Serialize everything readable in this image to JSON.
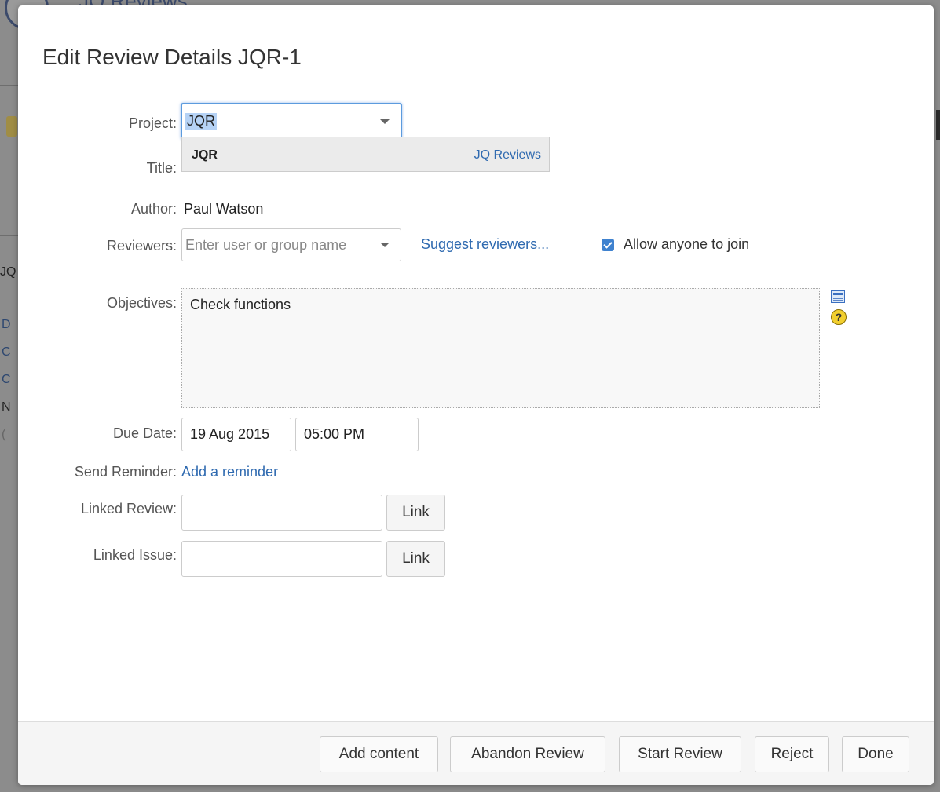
{
  "background": {
    "app_title": "JQ Reviews",
    "side_chars": [
      "JQ",
      "D",
      "C",
      "C",
      "N",
      "("
    ]
  },
  "dialog": {
    "title": "Edit Review Details JQR-1",
    "project": {
      "label": "Project:",
      "value": "JQR",
      "dropdown_key": "JQR",
      "dropdown_name": "JQ Reviews"
    },
    "title_field": {
      "label": "Title:"
    },
    "author": {
      "label": "Author:",
      "value": "Paul Watson"
    },
    "reviewers": {
      "label": "Reviewers:",
      "placeholder": "Enter user or group name",
      "suggest_link": "Suggest reviewers...",
      "allow_join_label": "Allow anyone to join",
      "allow_join_checked": true
    },
    "objectives": {
      "label": "Objectives:",
      "value": "Check functions"
    },
    "due_date": {
      "label": "Due Date:",
      "date": "19 Aug 2015",
      "time": "05:00 PM"
    },
    "reminder": {
      "label": "Send Reminder:",
      "link": "Add a reminder"
    },
    "linked_review": {
      "label": "Linked Review:",
      "value": "",
      "button": "Link"
    },
    "linked_issue": {
      "label": "Linked Issue:",
      "value": "",
      "button": "Link"
    },
    "footer": {
      "add_content": "Add content",
      "abandon": "Abandon Review",
      "start": "Start Review",
      "reject": "Reject",
      "done": "Done"
    }
  },
  "colors": {
    "link": "#2f6ab0",
    "focus": "#5c9bde",
    "checkbox": "#3f82cf"
  }
}
